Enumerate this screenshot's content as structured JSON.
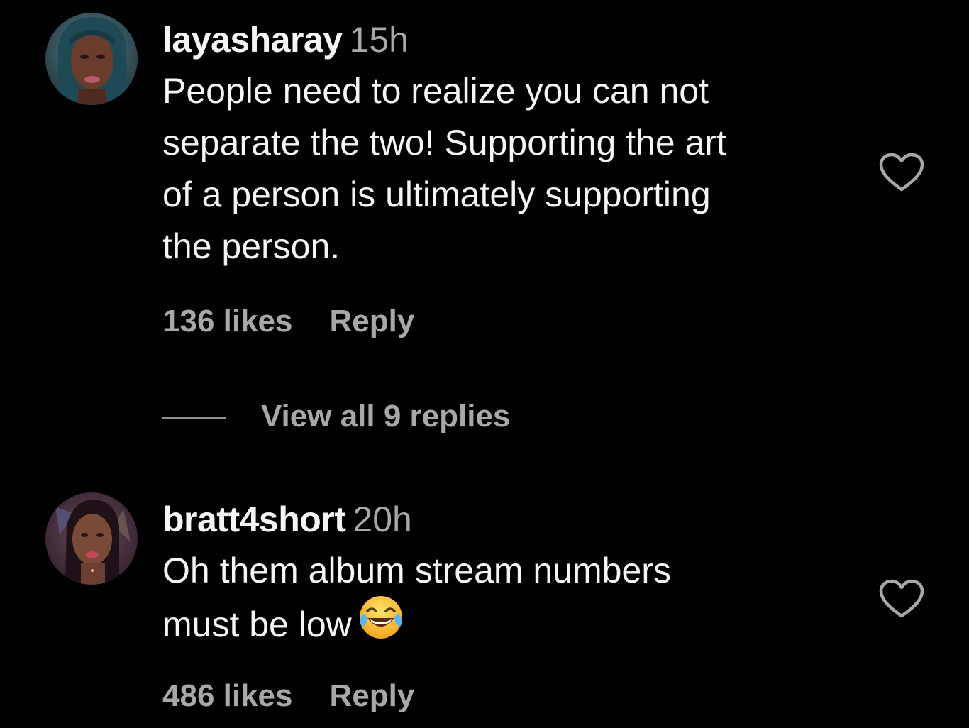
{
  "comments": [
    {
      "username": "layasharay",
      "timestamp": "15h",
      "text_lines": [
        "People need to realize you can not",
        "separate the two! Supporting the art",
        "of a person is ultimately supporting",
        "the person."
      ],
      "likes": "136 likes",
      "reply": "Reply",
      "view_replies": "View all 9 replies",
      "heart_icon": "heart-outline"
    },
    {
      "username": "bratt4short",
      "timestamp": "20h",
      "text_lines": [
        "Oh them album stream numbers",
        "must be low"
      ],
      "emoji": "face-with-tears-of-joy",
      "likes": "486 likes",
      "reply": "Reply",
      "heart_icon": "heart-outline"
    }
  ],
  "colors": {
    "background": "#000000",
    "primary_text": "#f5f5f5",
    "secondary_text": "#a8a8a8"
  }
}
